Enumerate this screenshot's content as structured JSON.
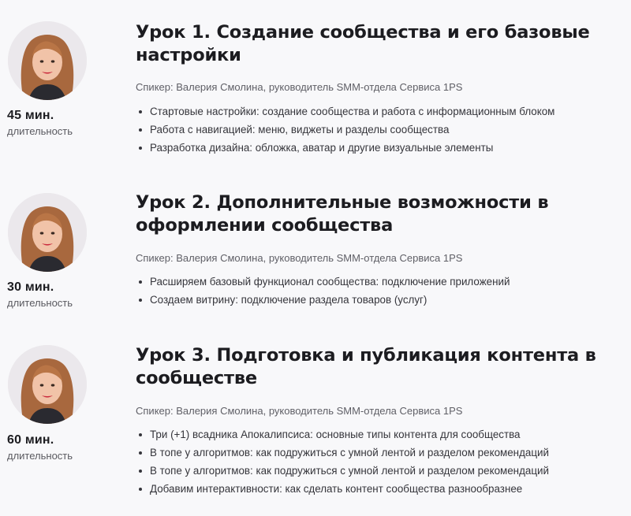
{
  "lessons": [
    {
      "title": "Урок 1. Создание сообщества и его базовые настройки",
      "duration": "45 мин.",
      "duration_label": "длительность",
      "speaker": "Спикер: Валерия Смолина, руководитель SMM-отдела Сервиса 1PS",
      "topics": [
        "Стартовые настройки: создание сообщества и работа с информационным блоком",
        "Работа с навигацией: меню, виджеты и разделы сообщества",
        "Разработка дизайна: обложка, аватар и другие визуальные элементы"
      ]
    },
    {
      "title": "Урок 2. Дополнительные возможности в оформлении сообщества",
      "duration": "30 мин.",
      "duration_label": "длительность",
      "speaker": "Спикер: Валерия Смолина, руководитель SMM-отдела Сервиса 1PS",
      "topics": [
        "Расширяем базовый функционал сообщества: подключение приложений",
        "Создаем витрину: подключение раздела товаров (услуг)"
      ]
    },
    {
      "title": "Урок 3. Подготовка и публикация контента в сообществе",
      "duration": "60 мин.",
      "duration_label": "длительность",
      "speaker": "Спикер: Валерия Смолина, руководитель SMM-отдела Сервиса 1PS",
      "topics": [
        "Три (+1) всадника Апокалипсиса: основные типы контента для сообщества",
        "В топе у алгоритмов: как подружиться с умной лентой и разделом рекомендаций",
        "В топе у алгоритмов: как подружиться с умной лентой и разделом рекомендаций",
        "Добавим интерактивности: как сделать контент сообщества разнообразнее"
      ]
    }
  ],
  "colors": {
    "background": "#f8f8fa",
    "title": "#1c1c20",
    "muted_text": "#5f5f66",
    "hair": "#a8683e",
    "lips": "#c9263a"
  }
}
